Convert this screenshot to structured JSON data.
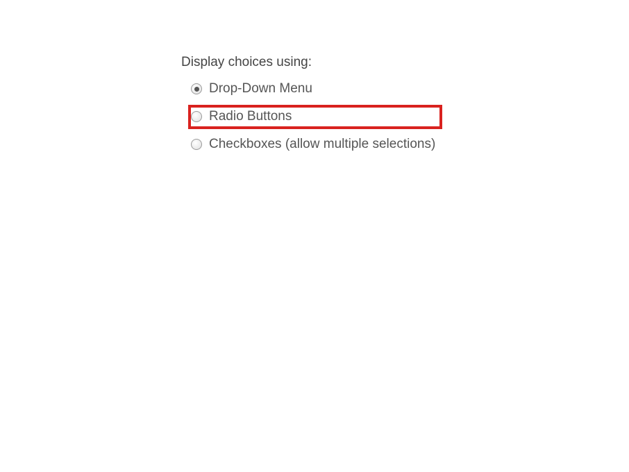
{
  "form": {
    "section_label": "Display choices using:",
    "options": [
      {
        "label": "Drop-Down Menu",
        "selected": true,
        "highlighted": false
      },
      {
        "label": "Radio Buttons",
        "selected": false,
        "highlighted": true
      },
      {
        "label": "Checkboxes (allow multiple selections)",
        "selected": false,
        "highlighted": false
      }
    ]
  }
}
